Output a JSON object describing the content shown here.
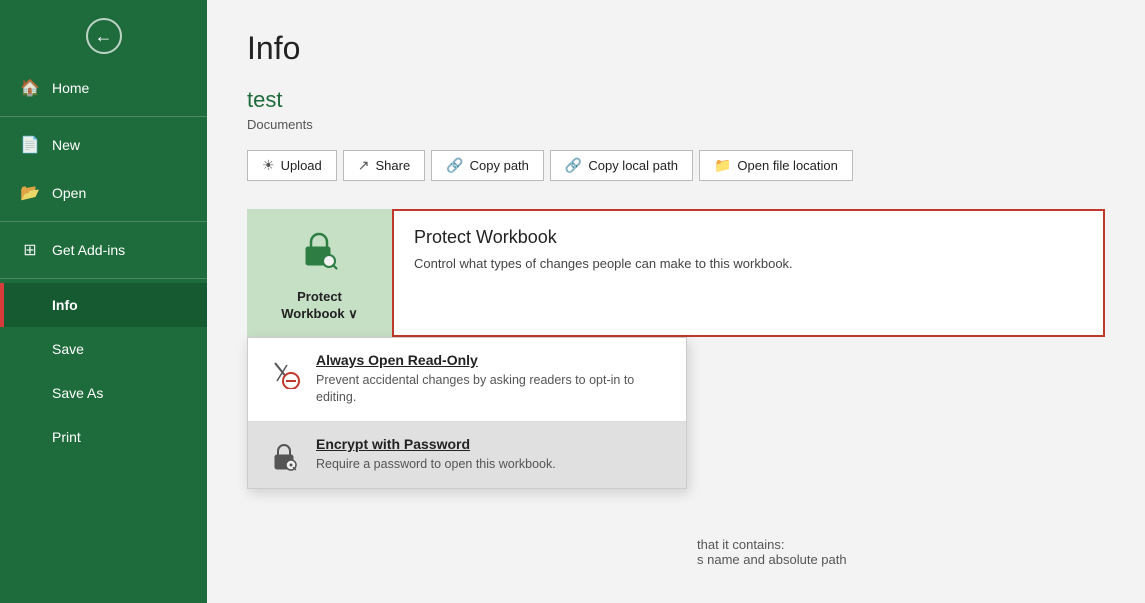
{
  "sidebar": {
    "back_label": "Back",
    "items": [
      {
        "id": "home",
        "label": "Home",
        "icon": "🏠"
      },
      {
        "id": "new",
        "label": "New",
        "icon": "📄"
      },
      {
        "id": "open",
        "label": "Open",
        "icon": "📂"
      },
      {
        "id": "get-add-ins",
        "label": "Get Add-ins",
        "icon": "⊞"
      },
      {
        "id": "info",
        "label": "Info",
        "icon": ""
      },
      {
        "id": "save",
        "label": "Save",
        "icon": ""
      },
      {
        "id": "save-as",
        "label": "Save As",
        "icon": ""
      },
      {
        "id": "print",
        "label": "Print",
        "icon": ""
      }
    ]
  },
  "main": {
    "page_title": "Info",
    "file_name": "test",
    "file_location": "Documents",
    "action_buttons": [
      {
        "id": "upload",
        "label": "Upload",
        "icon": "☁"
      },
      {
        "id": "share",
        "label": "Share",
        "icon": "↗"
      },
      {
        "id": "copy-path",
        "label": "Copy path",
        "icon": "🔗"
      },
      {
        "id": "copy-local-path",
        "label": "Copy local path",
        "icon": "🔗"
      },
      {
        "id": "open-file-location",
        "label": "Open file location",
        "icon": "📁"
      }
    ],
    "protect_workbook": {
      "tile_label": "Protect\nWorkbook",
      "tile_label_line1": "Protect",
      "tile_label_line2": "Workbook ∨",
      "info_title": "Protect Workbook",
      "info_desc": "Control what types of changes people can make to this workbook.",
      "dropdown": {
        "items": [
          {
            "id": "always-open-read-only",
            "title": "Always Open Read-Only",
            "desc": "Prevent accidental changes by asking readers to opt-in to editing.",
            "icon": "✏🚫",
            "selected": false
          },
          {
            "id": "encrypt-with-password",
            "title": "Encrypt with Password",
            "desc": "Require a password to open this workbook.",
            "icon": "🔒",
            "selected": true
          }
        ]
      }
    },
    "properties_partial": {
      "text": "that it contains:",
      "text2": "s name and absolute path"
    }
  }
}
